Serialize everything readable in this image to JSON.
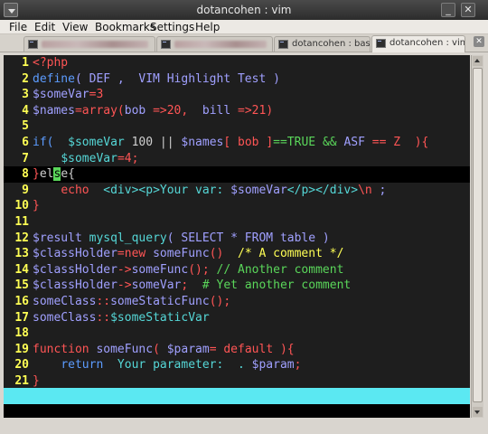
{
  "window": {
    "title": "dotancohen : vim",
    "minimize_glyph": "_",
    "close_glyph": "✕"
  },
  "menubar": [
    "File",
    "Edit",
    "View",
    "Bookmarks",
    "Settings",
    "Help"
  ],
  "tabs": [
    {
      "label": "",
      "redacted": true,
      "active": false
    },
    {
      "label": "",
      "redacted": true,
      "active": false
    },
    {
      "label": "dotancohen : bash",
      "active": false
    },
    {
      "label": "dotancohen : vim",
      "active": true
    }
  ],
  "tab_close_glyph": "✕",
  "editor": {
    "current_line": 8,
    "lines": [
      {
        "n": "1",
        "t": [
          [
            "<?php",
            "k1"
          ]
        ]
      },
      {
        "n": "2",
        "t": [
          [
            "define",
            "k2"
          ],
          [
            "( DEF ,  VIM Highlight Test )",
            "k5"
          ]
        ]
      },
      {
        "n": "3",
        "t": [
          [
            "$someVar",
            "k5"
          ],
          [
            "=3",
            "k1"
          ]
        ]
      },
      {
        "n": "4",
        "t": [
          [
            "$names",
            "k5"
          ],
          [
            "=array(",
            "k1"
          ],
          [
            "bob",
            "k5"
          ],
          [
            " =>20,  ",
            "k1"
          ],
          [
            "bill",
            "k5"
          ],
          [
            " =>21)",
            "k1"
          ]
        ]
      },
      {
        "n": "5",
        "t": []
      },
      {
        "n": "6",
        "t": [
          [
            "if(",
            "k2"
          ],
          [
            "  ",
            "k7"
          ],
          [
            "$someVar",
            "k3"
          ],
          [
            " 100 || ",
            "k7"
          ],
          [
            "$names",
            "k5"
          ],
          [
            "[ bob ]",
            "k1"
          ],
          [
            "==TRUE && ",
            "k4"
          ],
          [
            "ASF",
            "k5"
          ],
          [
            " == Z  ){",
            "k1"
          ]
        ]
      },
      {
        "n": "7",
        "t": [
          [
            "    ",
            "k7"
          ],
          [
            "$someVar",
            "k3"
          ],
          [
            "=4;",
            "k1"
          ]
        ]
      },
      {
        "n": "8",
        "t": [
          [
            "}",
            "k1"
          ],
          [
            "el",
            "k7"
          ],
          [
            "s",
            "cursor"
          ],
          [
            "e{",
            "k7"
          ]
        ]
      },
      {
        "n": "9",
        "t": [
          [
            "    ",
            "k7"
          ],
          [
            "echo",
            "k1"
          ],
          [
            "  <div><p>Your var: ",
            "k3"
          ],
          [
            "$someVar",
            "k5"
          ],
          [
            "</p></div>",
            "k3"
          ],
          [
            "\\n",
            "k1"
          ],
          [
            " ;",
            "k5"
          ]
        ]
      },
      {
        "n": "10",
        "t": [
          [
            "}",
            "k1"
          ]
        ]
      },
      {
        "n": "11",
        "t": []
      },
      {
        "n": "12",
        "t": [
          [
            "$result",
            "k5"
          ],
          [
            " mysql_query",
            "k3"
          ],
          [
            "( SELECT * FROM table )",
            "k5"
          ]
        ]
      },
      {
        "n": "13",
        "t": [
          [
            "$classHolder",
            "k5"
          ],
          [
            "=new ",
            "k1"
          ],
          [
            "someFunc",
            "k5"
          ],
          [
            "()",
            "k1"
          ],
          [
            "  /* A comment */",
            "k6"
          ]
        ]
      },
      {
        "n": "14",
        "t": [
          [
            "$classHolder",
            "k5"
          ],
          [
            "->",
            "k1"
          ],
          [
            "someFunc",
            "k5"
          ],
          [
            "();",
            "k1"
          ],
          [
            " // Another comment",
            "k4"
          ]
        ]
      },
      {
        "n": "15",
        "t": [
          [
            "$classHolder",
            "k5"
          ],
          [
            "->",
            "k1"
          ],
          [
            "someVar",
            "k5"
          ],
          [
            ";",
            "k1"
          ],
          [
            "  # Yet another comment",
            "k4"
          ]
        ]
      },
      {
        "n": "16",
        "t": [
          [
            "someClass",
            "k5"
          ],
          [
            "::",
            "k1"
          ],
          [
            "someStaticFunc",
            "k5"
          ],
          [
            "();",
            "k1"
          ]
        ]
      },
      {
        "n": "17",
        "t": [
          [
            "someClass",
            "k5"
          ],
          [
            "::",
            "k1"
          ],
          [
            "$someStaticVar",
            "k3"
          ]
        ]
      },
      {
        "n": "18",
        "t": []
      },
      {
        "n": "19",
        "t": [
          [
            "function",
            "k1"
          ],
          [
            " ",
            "k7"
          ],
          [
            "someFunc",
            "k5"
          ],
          [
            "( ",
            "k1"
          ],
          [
            "$param",
            "k5"
          ],
          [
            "= default ){",
            "k1"
          ]
        ]
      },
      {
        "n": "20",
        "t": [
          [
            "    ",
            "k7"
          ],
          [
            "return",
            "k2"
          ],
          [
            "  Your parameter:  . ",
            "k3"
          ],
          [
            "$param",
            "k5"
          ],
          [
            ";",
            "k1"
          ]
        ]
      },
      {
        "n": "21",
        "t": [
          [
            "}",
            "k1"
          ]
        ]
      }
    ]
  },
  "statusline": "",
  "commandline": "",
  "colors": {
    "background": "#1e1e1e",
    "current_line": "#000000",
    "line_numbers": "#ffff54",
    "statusline": "#5be8f2"
  }
}
